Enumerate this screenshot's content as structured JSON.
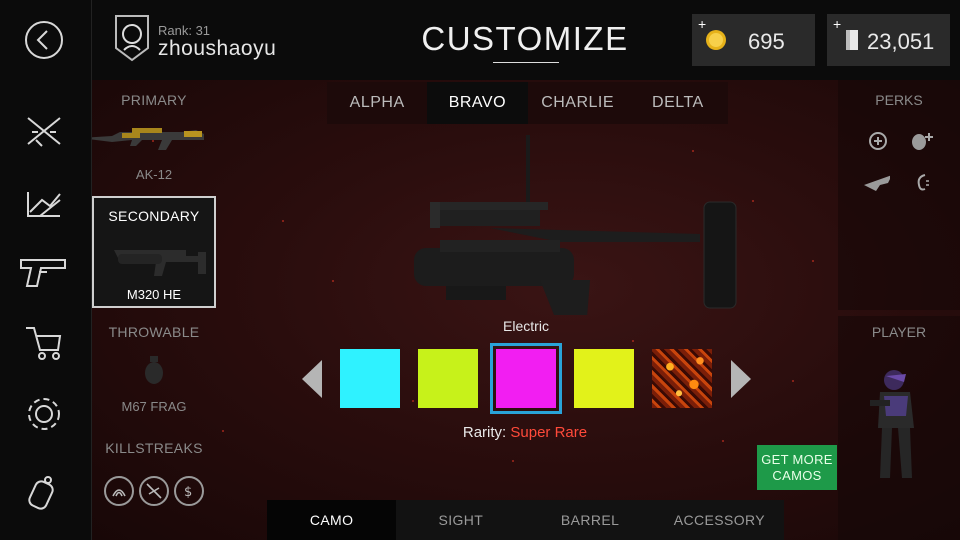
{
  "header": {
    "rank": "Rank: 31",
    "username": "zhoushaoyu",
    "title": "CUSTOMIZE",
    "coins": "695",
    "cash": "23,051"
  },
  "left_rail": {
    "items": [
      "back-icon",
      "weapons-icon",
      "map-icon",
      "pistol-icon",
      "shop-cart-icon",
      "settings-gear-icon",
      "dog-tag-icon"
    ]
  },
  "weapons": {
    "primary": {
      "label": "PRIMARY",
      "name": "AK-12"
    },
    "secondary": {
      "label": "SECONDARY",
      "name": "M320 HE"
    },
    "throwable": {
      "label": "THROWABLE",
      "name": "M67 FRAG"
    },
    "killstreaks_label": "KILLSTREAKS",
    "killstreak_icons": [
      "radar-icon",
      "no-drone-icon",
      "cash-drop-icon"
    ]
  },
  "loadout_tabs": [
    "ALPHA",
    "BRAVO",
    "CHARLIE",
    "DELTA"
  ],
  "active_loadout": "BRAVO",
  "perks": {
    "label": "PERKS",
    "icons": [
      "medkit-icon",
      "grenade-plus-icon",
      "wing-icon",
      "ear-icon"
    ]
  },
  "player": {
    "label": "PLAYER"
  },
  "camo": {
    "selected_name": "Electric",
    "rarity_label": "Rarity:",
    "rarity_value": "Super Rare",
    "swatches": [
      "#2ff2ff",
      "#c7f21a",
      "#f21ef2",
      "#e2f21a",
      "lava"
    ],
    "selected_index": 2,
    "rarity_color": "#ff4a3a"
  },
  "get_more_button": "GET MORE CAMOS",
  "bottom_tabs": [
    "CAMO",
    "SIGHT",
    "BARREL",
    "ACCESSORY"
  ],
  "active_bottom_tab": "CAMO",
  "colors": {
    "accent_blue": "#29a3d8",
    "green_button": "#1e9a49"
  }
}
